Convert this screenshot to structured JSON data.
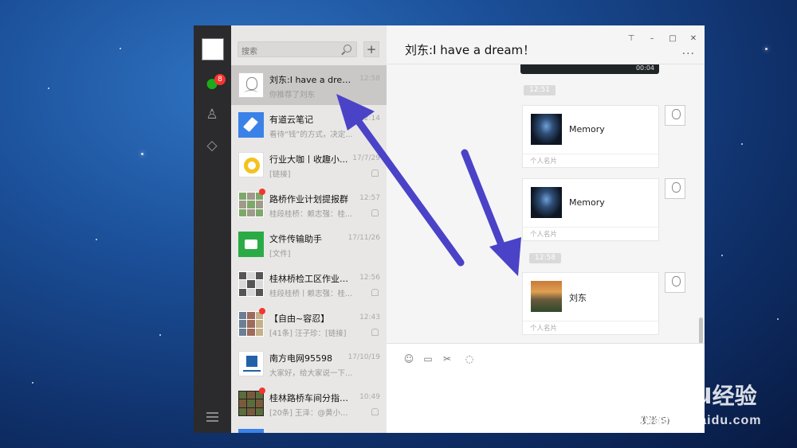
{
  "app": {
    "search_placeholder": "搜索",
    "add_label": "+",
    "nav_badge": "8"
  },
  "chat_list": [
    {
      "name": "刘东:I have a drea...",
      "preview": "你推荐了刘东",
      "time": "12:58",
      "avatar": "face",
      "active": true,
      "muted": false,
      "unread": false
    },
    {
      "name": "有道云笔记",
      "preview": "看待“钱”的方式，决定...",
      "time": "12:14",
      "avatar": "youdao",
      "active": false,
      "muted": false,
      "unread": false
    },
    {
      "name": "行业大咖丨收趣小...",
      "preview": "[链接]",
      "time": "17/7/29",
      "avatar": "yellow",
      "active": false,
      "muted": true,
      "unread": false
    },
    {
      "name": "路桥作业计划提报群",
      "preview": "桂段桂桥：赖志强：桂...",
      "time": "12:57",
      "avatar": "grid-green",
      "active": false,
      "muted": true,
      "unread": true
    },
    {
      "name": "文件传输助手",
      "preview": "[文件]",
      "time": "17/11/26",
      "avatar": "file",
      "active": false,
      "muted": false,
      "unread": false
    },
    {
      "name": "桂林桥检工区作业计划",
      "preview": "桂段桂桥丨赖志强：桂...",
      "time": "12:56",
      "avatar": "grid-bw",
      "active": false,
      "muted": true,
      "unread": false
    },
    {
      "name": "【自由~容忍】",
      "preview": "[41条] 汪子珍：[链接]",
      "time": "12:43",
      "avatar": "grid-mix",
      "active": false,
      "muted": true,
      "unread": true
    },
    {
      "name": "南方电网95598",
      "preview": "大家好，给大家说一下，...",
      "time": "17/10/19",
      "avatar": "csg",
      "active": false,
      "muted": false,
      "unread": false
    },
    {
      "name": "桂林路桥车间分指挥...",
      "preview": "[20条] 王泽：@黄小飞 ...",
      "time": "10:49",
      "avatar": "grid-dark",
      "active": false,
      "muted": true,
      "unread": true
    }
  ],
  "chat": {
    "title": "刘东:I have a dream！",
    "more_label": "...",
    "video_time": "00:04",
    "messages": [
      {
        "type": "time",
        "text": "12:51"
      },
      {
        "type": "card",
        "name": "Memory",
        "label": "个人名片",
        "thumb": "night"
      },
      {
        "type": "card",
        "name": "Memory",
        "label": "个人名片",
        "thumb": "night"
      },
      {
        "type": "time",
        "text": "12:58"
      },
      {
        "type": "card",
        "name": "刘东",
        "label": "个人名片",
        "thumb": "sunset"
      }
    ],
    "send_label": "发送(S)",
    "window_controls": [
      "pin-icon",
      "minimize-icon",
      "maximize-icon",
      "close-icon"
    ]
  },
  "watermark": {
    "brand_left": "Bai",
    "brand_right": "du",
    "brand_cn": "经验",
    "site": "jingyan.baidu.com"
  }
}
